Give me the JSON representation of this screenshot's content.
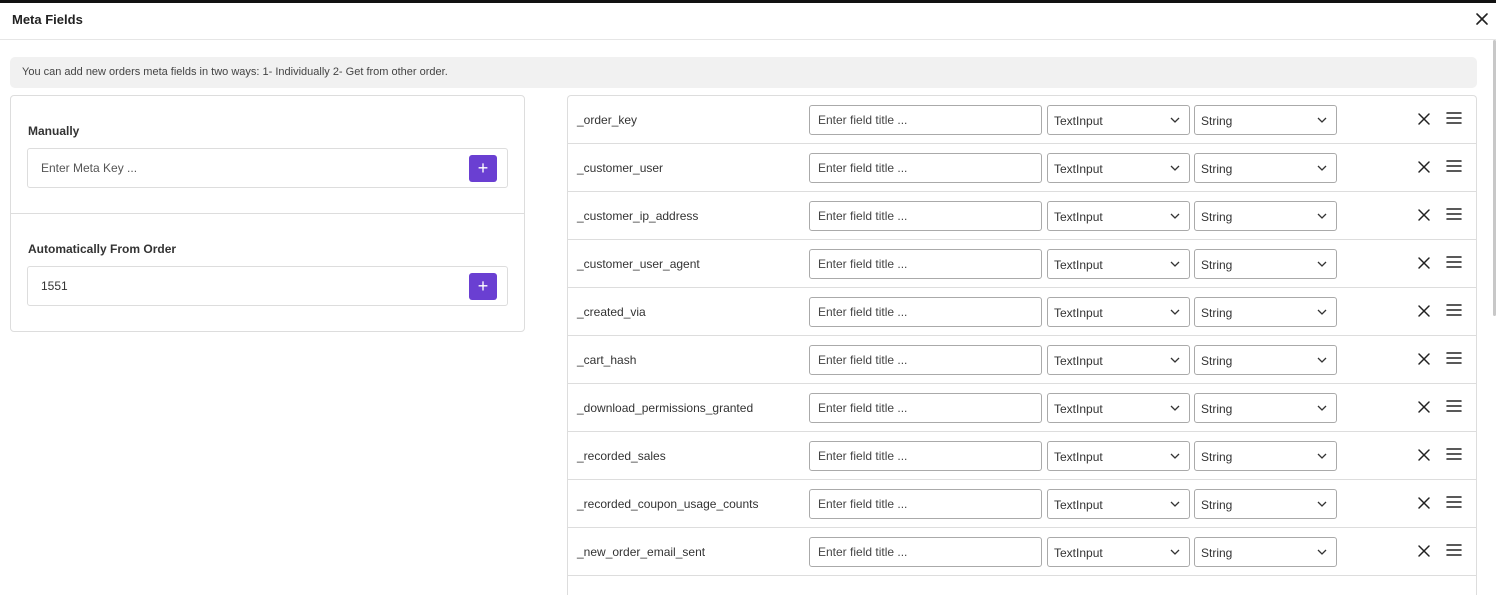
{
  "header": {
    "title": "Meta Fields"
  },
  "notice": "You can add new orders meta fields in two ways: 1- Individually 2- Get from other order.",
  "manual": {
    "label": "Manually",
    "placeholder": "Enter Meta Key ...",
    "value": "",
    "add_label": "+"
  },
  "auto": {
    "label": "Automatically From Order",
    "placeholder": "",
    "value": "1551",
    "add_label": "+"
  },
  "field_title_placeholder": "Enter field title ...",
  "rows": [
    {
      "key": "_order_key",
      "type": "TextInput",
      "data_type": "String"
    },
    {
      "key": "_customer_user",
      "type": "TextInput",
      "data_type": "String"
    },
    {
      "key": "_customer_ip_address",
      "type": "TextInput",
      "data_type": "String"
    },
    {
      "key": "_customer_user_agent",
      "type": "TextInput",
      "data_type": "String"
    },
    {
      "key": "_created_via",
      "type": "TextInput",
      "data_type": "String"
    },
    {
      "key": "_cart_hash",
      "type": "TextInput",
      "data_type": "String"
    },
    {
      "key": "_download_permissions_granted",
      "type": "TextInput",
      "data_type": "String"
    },
    {
      "key": "_recorded_sales",
      "type": "TextInput",
      "data_type": "String"
    },
    {
      "key": "_recorded_coupon_usage_counts",
      "type": "TextInput",
      "data_type": "String"
    },
    {
      "key": "_new_order_email_sent",
      "type": "TextInput",
      "data_type": "String"
    }
  ],
  "colors": {
    "accent": "#6a3fd2",
    "border": "#dddddd"
  },
  "icons": {
    "close": "close-icon",
    "delete": "delete-row-icon",
    "drag": "drag-handle-icon",
    "dropdown": "chevron-down-icon"
  }
}
